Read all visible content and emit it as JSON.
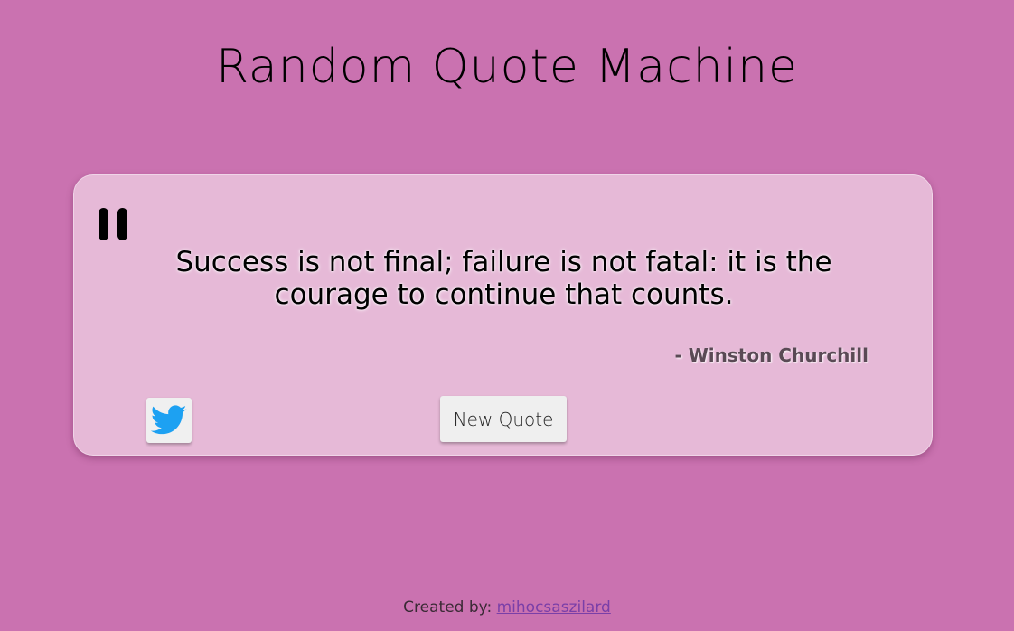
{
  "header": {
    "title": "Random Quote Machine"
  },
  "quote": {
    "text": "Success is not final; failure is not fatal: it is the courage to continue that counts.",
    "author": "- Winston Churchill"
  },
  "actions": {
    "tweet_icon": "twitter-icon",
    "new_quote_label": "New Quote"
  },
  "footer": {
    "prefix": "Created by: ",
    "author_link": "mihocsaszilard"
  },
  "colors": {
    "background": "#ca72b0",
    "card": "#e6b9d7",
    "twitter": "#1da1f2",
    "link": "#7a3fa8"
  }
}
